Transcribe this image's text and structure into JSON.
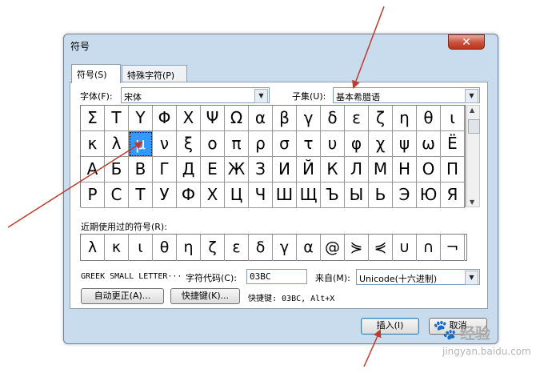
{
  "dialog": {
    "title": "符号",
    "close_glyph": "✕"
  },
  "tabs": [
    {
      "label": "符号(S)"
    },
    {
      "label": "特殊字符(P)"
    }
  ],
  "font": {
    "label": "字体(F):",
    "value": "宋体"
  },
  "subset": {
    "label": "子集(U):",
    "value": "基本希腊语"
  },
  "symbols": [
    [
      "Σ",
      "Τ",
      "Υ",
      "Φ",
      "Χ",
      "Ψ",
      "Ω",
      "α",
      "β",
      "γ",
      "δ",
      "ε",
      "ζ",
      "η",
      "θ",
      "ι"
    ],
    [
      "κ",
      "λ",
      "μ",
      "ν",
      "ξ",
      "ο",
      "π",
      "ρ",
      "σ",
      "τ",
      "υ",
      "φ",
      "χ",
      "ψ",
      "ω",
      "Ё"
    ],
    [
      "А",
      "Б",
      "В",
      "Г",
      "Д",
      "Е",
      "Ж",
      "З",
      "И",
      "Й",
      "К",
      "Л",
      "М",
      "Н",
      "О",
      "П"
    ],
    [
      "Р",
      "С",
      "Т",
      "У",
      "Ф",
      "Х",
      "Ц",
      "Ч",
      "Ш",
      "Щ",
      "Ъ",
      "Ы",
      "Ь",
      "Э",
      "Ю",
      "Я"
    ]
  ],
  "selected_symbol": {
    "row": 1,
    "col": 2
  },
  "recent": {
    "label": "近期使用过的符号(R):",
    "items": [
      "λ",
      "κ",
      "ι",
      "θ",
      "η",
      "ζ",
      "ε",
      "δ",
      "γ",
      "α",
      "@",
      "⋟",
      "⋞",
      "∪",
      "∩",
      "¬"
    ]
  },
  "char_name": "GREEK SMALL LETTER···",
  "char_code": {
    "label": "字符代码(C):",
    "value": "03BC"
  },
  "from": {
    "label": "来自(M):",
    "value": "Unicode(十六进制)"
  },
  "buttons": {
    "autocorrect": "自动更正(A)...",
    "shortcut_key": "快捷键(K)...",
    "shortcut_text": "快捷键: 03BC, Alt+X",
    "insert": "插入(I)",
    "cancel": "取消"
  },
  "watermark": {
    "text": "经验",
    "url": "jingyan.baidu.com"
  },
  "colors": {
    "selection": "#3399ff",
    "arrow": "#c0392b",
    "window_frame": "#c9dcee"
  }
}
